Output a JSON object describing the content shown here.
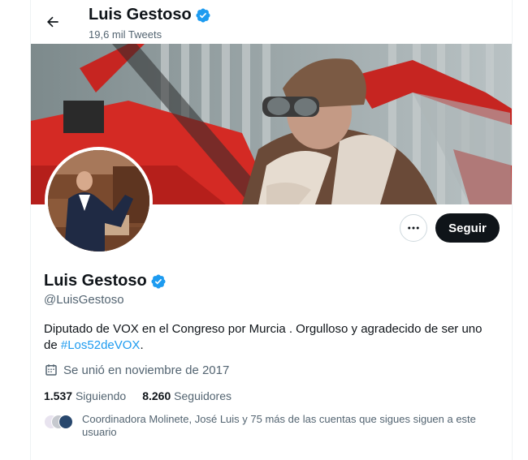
{
  "header": {
    "name": "Luis Gestoso",
    "tweet_count": "19,6 mil Tweets"
  },
  "profile": {
    "name": "Luis Gestoso",
    "handle": "@LuisGestoso",
    "bio_text": "Diputado de VOX en el Congreso por Murcia . Orgulloso y agradecido de ser uno de",
    "bio_hashtag": "#Los52deVOX",
    "bio_end": ".",
    "joined": "Se unió en noviembre de 2017",
    "following_count": "1.537",
    "following_label": "Siguiendo",
    "followers_count": "8.260",
    "followers_label": "Seguidores",
    "followed_by": "Coordinadora Molinete, José Luis y 75 más de las cuentas que sigues siguen a este usuario"
  },
  "actions": {
    "follow_label": "Seguir",
    "more_label": "•••"
  },
  "colors": {
    "accent": "#1d9bf0",
    "follow_bg": "#0f1419",
    "muted": "#536471"
  },
  "icons": [
    "back-arrow-icon",
    "verified-badge-icon",
    "calendar-icon",
    "more-icon"
  ]
}
